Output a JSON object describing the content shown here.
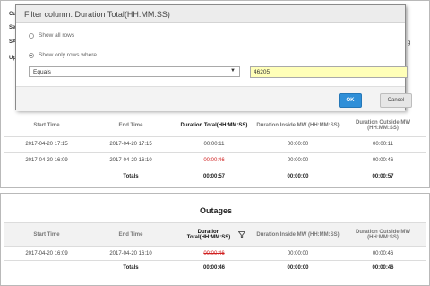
{
  "background": {
    "label_1": "Cu",
    "label_2": "Se",
    "label_3": "SA",
    "label_4": "Up",
    "right_fragment": "g"
  },
  "dialog": {
    "title": "Filter column: Duration Total(HH:MM:SS)",
    "radio_all": "Show all rows",
    "radio_only": "Show only rows where",
    "selected_radio": "Show only rows where",
    "operator": "Equals",
    "value": "46205",
    "ok_label": "OK",
    "cancel_label": "Cancel"
  },
  "table1": {
    "headers": [
      "Start Time",
      "End Time",
      "Duration Total(HH:MM:SS)",
      "Duration Inside MW (HH:MM:SS)",
      "Duration Outside MW (HH:MM:SS)"
    ],
    "rows": [
      [
        "2017-04-20 17:15",
        "2017-04-20 17:15",
        "00:00:11",
        "00:00:00",
        "00:00:11"
      ],
      [
        "2017-04-20 16:09",
        "2017-04-20 16:10",
        "00:00:46",
        "00:00:00",
        "00:00:46"
      ]
    ],
    "totals": [
      "",
      "Totals",
      "00:00:57",
      "00:00:00",
      "00:00:57"
    ]
  },
  "outages": {
    "title": "Outages",
    "headers": [
      "Start Time",
      "End Time",
      "Duration Total(HH:MM:SS)",
      "Duration Inside MW (HH:MM:SS)",
      "Duration Outside MW (HH:MM:SS)"
    ],
    "rows": [
      [
        "2017-04-20 16:09",
        "2017-04-20 16:10",
        "00:00:46",
        "00:00:00",
        "00:00:46"
      ]
    ],
    "totals": [
      "",
      "Totals",
      "00:00:46",
      "00:00:00",
      "00:00:46"
    ]
  },
  "colors": {
    "accent": "#2f8fd8",
    "highlight": "#ffffb8",
    "error": "#d02020"
  }
}
